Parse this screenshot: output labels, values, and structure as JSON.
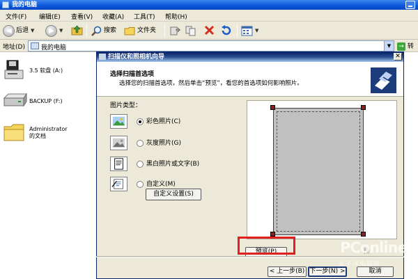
{
  "window": {
    "title": "我的电脑"
  },
  "menu": [
    "文件(F)",
    "编辑(E)",
    "查看(V)",
    "收藏(A)",
    "工具(T)",
    "帮助(H)"
  ],
  "toolbar": {
    "back": "后退",
    "search": "搜索",
    "folders": "文件夹"
  },
  "address": {
    "label": "地址(D)",
    "value": "我的电脑",
    "go": "转到"
  },
  "drives": [
    {
      "label": "3.5 软盘 (A:)"
    },
    {
      "label": "BACKUP (F:)"
    },
    {
      "label": "Administrator 的文档"
    }
  ],
  "wizard": {
    "title": "扫描仪和照相机向导",
    "heading": "选择扫描首选项",
    "subheading": "选择您的扫描首选项，然后单击“预览”，看您的首选项如何影响照片。",
    "picture_type_label": "图片类型：",
    "options": [
      {
        "label": "彩色照片(C)",
        "selected": true
      },
      {
        "label": "灰度照片(G)",
        "selected": false
      },
      {
        "label": "黑白照片或文字(B)",
        "selected": false
      },
      {
        "label": "自定义(M)",
        "selected": false
      }
    ],
    "custom_settings": "自定义设置(S)",
    "preview": "预览(P)",
    "faded_button": "预",
    "back": "< 上一步(B)",
    "next": "下一步(N) >",
    "cancel": "取消"
  },
  "watermark": {
    "brand": "PConline",
    "tagline": "太平洋电脑网"
  },
  "colors": {
    "highlight_border": "#e0201e",
    "title_blue": "#0a56d8",
    "dialog_title": "#0a246a"
  }
}
